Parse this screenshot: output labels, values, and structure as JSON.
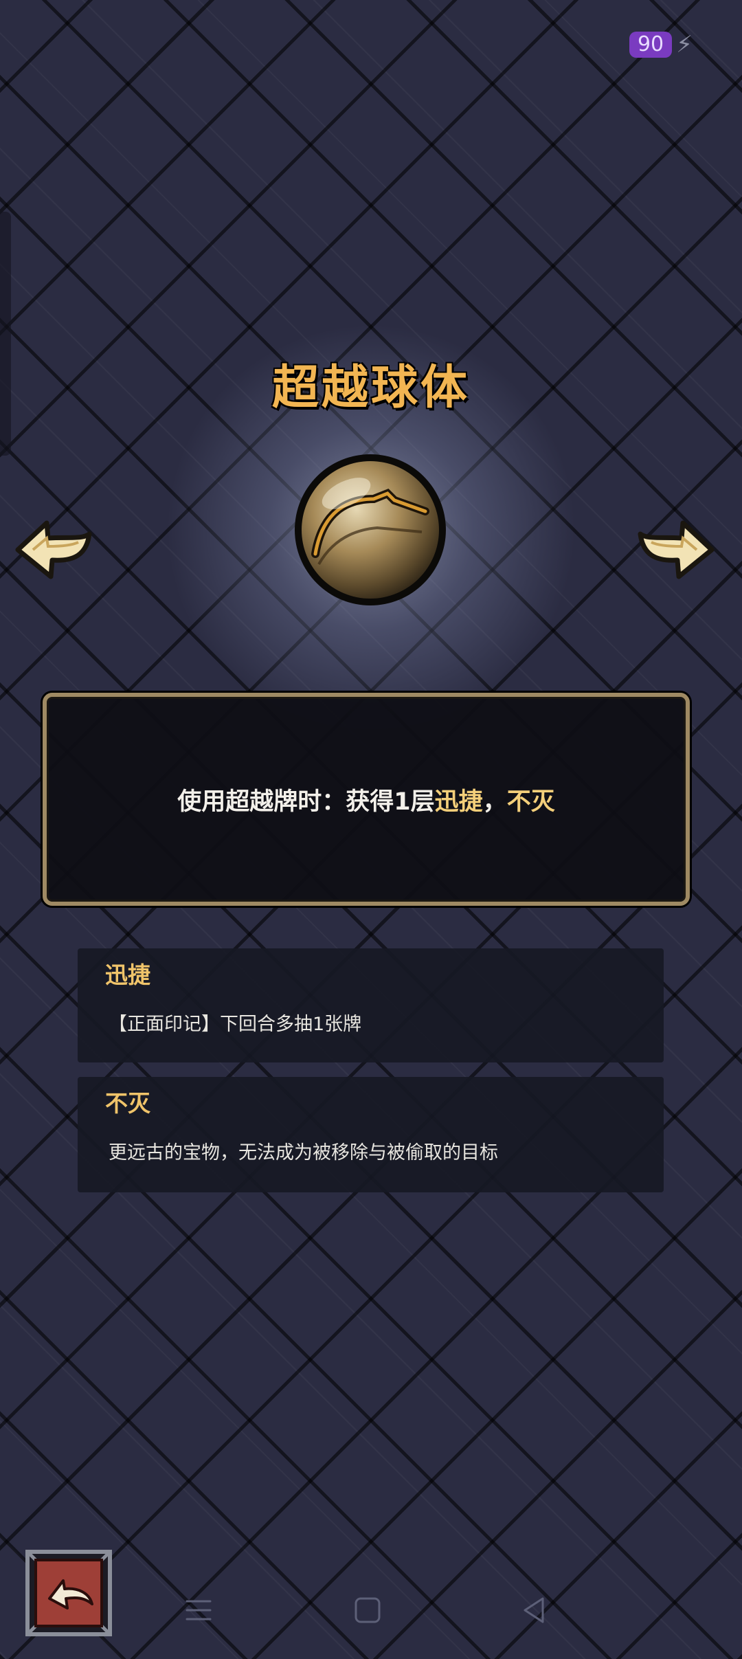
{
  "status": {
    "energy_value": "90",
    "energy_icon": "lightning-bolt-icon"
  },
  "relic": {
    "name": "超越球体",
    "effect_prefix": "使用超越牌时：获得1层",
    "keyword1": "迅捷",
    "separator": "，",
    "keyword2": "不灭",
    "name_color": "#f2b552",
    "keyword_color": "#f4cf7a"
  },
  "keywords": [
    {
      "title": "迅捷",
      "description": "【正面印记】下回合多抽1张牌"
    },
    {
      "title": "不灭",
      "description": "更远古的宝物，无法成为被移除与被偷取的目标"
    }
  ],
  "navigation": {
    "prev_icon": "arrow-left-icon",
    "next_icon": "arrow-right-icon",
    "back_icon": "return-arrow-icon"
  },
  "system_nav": {
    "menu_icon": "menu-lines-icon",
    "home_icon": "home-square-icon",
    "back_icon": "back-triangle-icon"
  }
}
